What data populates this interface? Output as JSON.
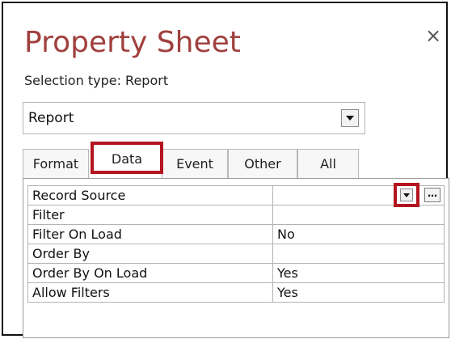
{
  "panel": {
    "title": "Property Sheet",
    "close_glyph": "×",
    "selection_type_label": "Selection type:",
    "selection_type_value": "Report"
  },
  "selector": {
    "value": "Report"
  },
  "tabs": [
    {
      "label": "Format",
      "active": false
    },
    {
      "label": "Data",
      "active": true
    },
    {
      "label": "Event",
      "active": false
    },
    {
      "label": "Other",
      "active": false
    },
    {
      "label": "All",
      "active": false
    }
  ],
  "properties": [
    {
      "name": "Record Source",
      "value": ""
    },
    {
      "name": "Filter",
      "value": ""
    },
    {
      "name": "Filter On Load",
      "value": "No"
    },
    {
      "name": "Order By",
      "value": ""
    },
    {
      "name": "Order By On Load",
      "value": "Yes"
    },
    {
      "name": "Allow Filters",
      "value": "Yes"
    }
  ],
  "builder_button_glyph": "…",
  "highlight_color": "#b3141f",
  "title_color": "#a0403e"
}
